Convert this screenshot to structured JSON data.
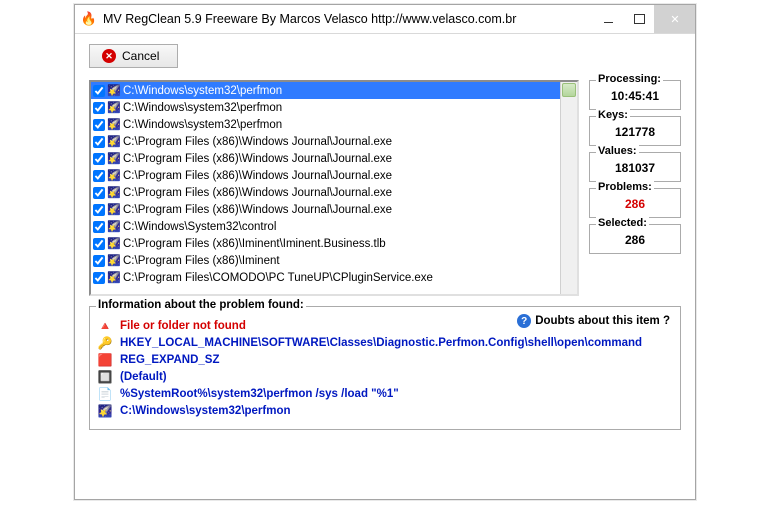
{
  "titlebar": {
    "title": "MV RegClean 5.9 Freeware   By Marcos Velasco   http://www.velasco.com.br"
  },
  "toolbar": {
    "cancel_label": "Cancel"
  },
  "list": {
    "items": [
      {
        "checked": true,
        "selected": true,
        "path": "C:\\Windows\\system32\\perfmon"
      },
      {
        "checked": true,
        "selected": false,
        "path": "C:\\Windows\\system32\\perfmon"
      },
      {
        "checked": true,
        "selected": false,
        "path": "C:\\Windows\\system32\\perfmon"
      },
      {
        "checked": true,
        "selected": false,
        "path": "C:\\Program Files (x86)\\Windows Journal\\Journal.exe"
      },
      {
        "checked": true,
        "selected": false,
        "path": "C:\\Program Files (x86)\\Windows Journal\\Journal.exe"
      },
      {
        "checked": true,
        "selected": false,
        "path": "C:\\Program Files (x86)\\Windows Journal\\Journal.exe"
      },
      {
        "checked": true,
        "selected": false,
        "path": "C:\\Program Files (x86)\\Windows Journal\\Journal.exe"
      },
      {
        "checked": true,
        "selected": false,
        "path": "C:\\Program Files (x86)\\Windows Journal\\Journal.exe"
      },
      {
        "checked": true,
        "selected": false,
        "path": "C:\\Windows\\System32\\control"
      },
      {
        "checked": true,
        "selected": false,
        "path": "C:\\Program Files (x86)\\Iminent\\Iminent.Business.tlb"
      },
      {
        "checked": true,
        "selected": false,
        "path": "C:\\Program Files (x86)\\Iminent"
      },
      {
        "checked": true,
        "selected": false,
        "path": "C:\\Program Files\\COMODO\\PC TuneUP\\CPluginService.exe"
      }
    ]
  },
  "stats": {
    "processing": {
      "label": "Processing:",
      "value": "10:45:41"
    },
    "keys": {
      "label": "Keys:",
      "value": "121778"
    },
    "values": {
      "label": "Values:",
      "value": "181037"
    },
    "problems": {
      "label": "Problems:",
      "value": "286"
    },
    "selected": {
      "label": "Selected:",
      "value": "286"
    }
  },
  "info": {
    "header": "Information about the problem found:",
    "doubts": "Doubts about this item ?",
    "rows": [
      {
        "style": "red",
        "icon": "🔺",
        "text": "File or folder not found"
      },
      {
        "style": "blue",
        "icon": "🔑",
        "text": "HKEY_LOCAL_MACHINE\\SOFTWARE\\Classes\\Diagnostic.Perfmon.Config\\shell\\open\\command"
      },
      {
        "style": "blue",
        "icon": "🟥",
        "text": "REG_EXPAND_SZ"
      },
      {
        "style": "blue",
        "icon": "🔲",
        "text": "(Default)"
      },
      {
        "style": "blue",
        "icon": "📄",
        "text": "%SystemRoot%\\system32\\perfmon /sys /load \"%1\""
      },
      {
        "style": "blue",
        "icon": "🌠",
        "text": "C:\\Windows\\system32\\perfmon"
      }
    ]
  }
}
